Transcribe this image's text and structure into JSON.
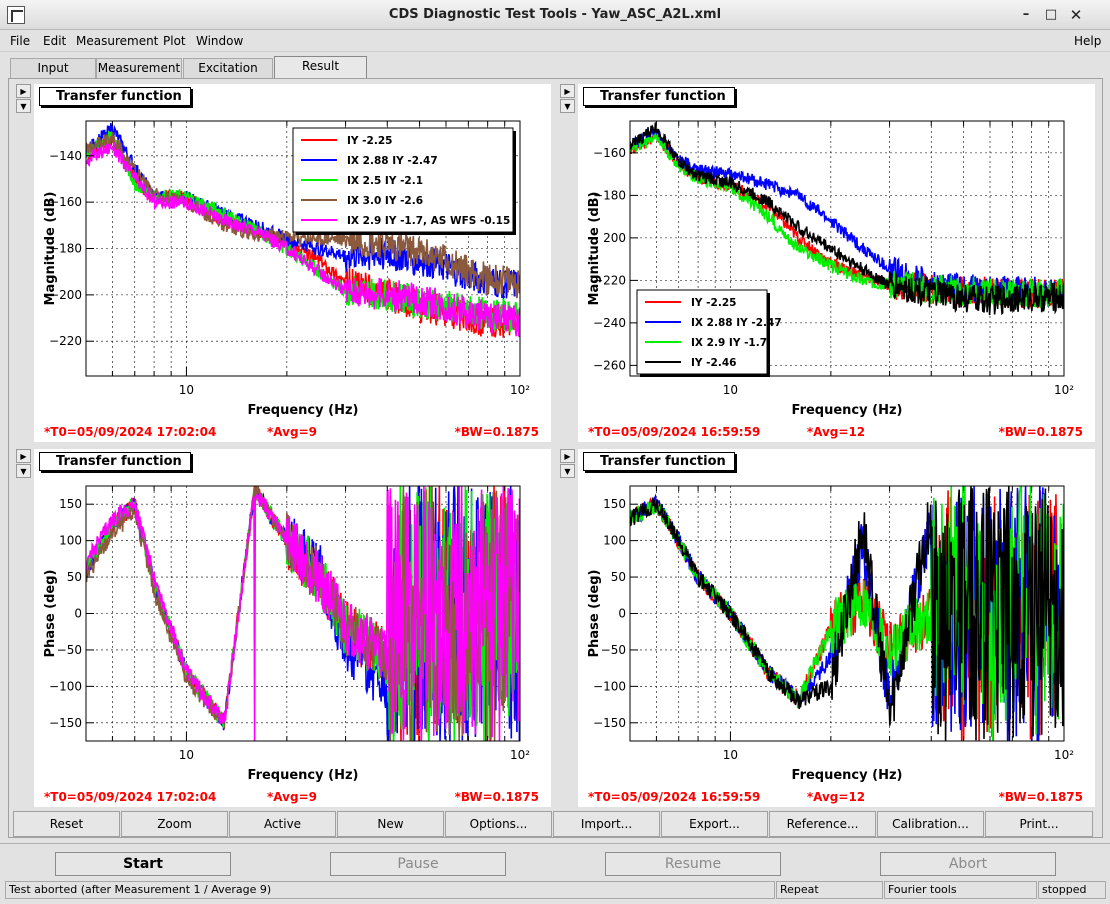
{
  "window": {
    "title": "CDS Diagnostic Test Tools - Yaw_ASC_A2L.xml",
    "minimize": "–",
    "maximize": "□",
    "close": "✕"
  },
  "menu": {
    "file": "File",
    "edit": "Edit",
    "measurement": "Measurement",
    "plot": "Plot",
    "window": "Window",
    "help": "Help"
  },
  "tabs": [
    "Input",
    "Measurement",
    "Excitation",
    "Result"
  ],
  "active_tab": "Result",
  "pads": [
    {
      "title": "Transfer function",
      "ylabel": "Magnitude (dB)",
      "xlabel": "Frequency (Hz)",
      "yticks": [
        "−140",
        "−160",
        "−180",
        "−200",
        "−220"
      ],
      "xtick10": "10",
      "xtick100": "10²",
      "footer": {
        "t0": "*T0=05/09/2024 17:02:04",
        "avg": "*Avg=9",
        "bw": "*BW=0.1875"
      },
      "legend": [
        {
          "label": "IY -2.25",
          "color": "#ff0000"
        },
        {
          "label": "IX 2.88 IY -2.47",
          "color": "#0000ff"
        },
        {
          "label": "IX 2.5 IY -2.1",
          "color": "#00ee00"
        },
        {
          "label": "IX 3.0 IY -2.6",
          "color": "#8b5a3c"
        },
        {
          "label": "IX 2.9 IY -1.7, AS WFS -0.15",
          "color": "#ff00ff"
        }
      ]
    },
    {
      "title": "Transfer function",
      "ylabel": "Magnitude (dB)",
      "xlabel": "Frequency (Hz)",
      "yticks": [
        "−160",
        "−180",
        "200",
        "−220",
        "−240",
        "−260"
      ],
      "xtick10": "10",
      "xtick100": "10²",
      "footer": {
        "t0": "*T0=05/09/2024 16:59:59",
        "avg": "*Avg=12",
        "bw": "*BW=0.1875"
      },
      "legend": [
        {
          "label": "IY -2.25",
          "color": "#ff0000"
        },
        {
          "label": "IX 2.88 IY -2.47",
          "color": "#0000ff"
        },
        {
          "label": "IX 2.9 IY -1.7",
          "color": "#00ee00"
        },
        {
          "label": "IY -2.46",
          "color": "#000000"
        }
      ]
    },
    {
      "title": "Transfer function",
      "ylabel": "Phase (deg)",
      "xlabel": "Frequency (Hz)",
      "yticks": [
        "150",
        "100",
        "50",
        "0",
        "−50",
        "−100",
        "−150"
      ],
      "xtick10": "10",
      "xtick100": "10²",
      "footer": {
        "t0": "*T0=05/09/2024 17:02:04",
        "avg": "*Avg=9",
        "bw": "*BW=0.1875"
      },
      "legend": []
    },
    {
      "title": "Transfer function",
      "ylabel": "Phase (deg)",
      "xlabel": "Frequency (Hz)",
      "yticks": [
        "150",
        "100",
        "50",
        "0",
        "−50",
        "−100",
        "−150"
      ],
      "xtick10": "10",
      "xtick100": "10²",
      "footer": {
        "t0": "*T0=05/09/2024 16:59:59",
        "avg": "*Avg=12",
        "bw": "*BW=0.1875"
      },
      "legend": []
    }
  ],
  "buttons": [
    "Reset",
    "Zoom",
    "Active",
    "New",
    "Options...",
    "Import...",
    "Export...",
    "Reference...",
    "Calibration...",
    "Print..."
  ],
  "controls": {
    "start": "Start",
    "pause": "Pause",
    "resume": "Resume",
    "abort": "Abort"
  },
  "status": {
    "message": "Test aborted (after Measurement 1 / Average 9)",
    "repeat": "Repeat",
    "fourier": "Fourier tools",
    "state": "stopped"
  },
  "chart_data": [
    {
      "type": "line",
      "title": "Transfer function",
      "xlabel": "Frequency (Hz)",
      "ylabel": "Magnitude (dB)",
      "xscale": "log",
      "xlim": [
        5,
        100
      ],
      "ylim": [
        -235,
        -125
      ],
      "grid": true,
      "legend_position": "top-right",
      "x": [
        5,
        6,
        7,
        8,
        10,
        13,
        16,
        20,
        25,
        30,
        40,
        50,
        60,
        70,
        80,
        100
      ],
      "series": [
        {
          "name": "IY -2.25",
          "color": "#ff0000",
          "values": [
            -140,
            -133,
            -150,
            -158,
            -158,
            -168,
            -172,
            -178,
            -185,
            -195,
            -200,
            -205,
            -207,
            -210,
            -212,
            -212
          ]
        },
        {
          "name": "IX 2.88 IY -2.47",
          "color": "#0000ff",
          "values": [
            -138,
            -128,
            -145,
            -158,
            -158,
            -165,
            -170,
            -176,
            -180,
            -183,
            -182,
            -185,
            -188,
            -192,
            -194,
            -196
          ]
        },
        {
          "name": "IX 2.5 IY -2.1",
          "color": "#00ee00",
          "values": [
            -139,
            -131,
            -152,
            -157,
            -158,
            -165,
            -172,
            -180,
            -190,
            -198,
            -200,
            -203,
            -205,
            -207,
            -208,
            -210
          ]
        },
        {
          "name": "IX 3.0 IY -2.6",
          "color": "#8b5a3c",
          "values": [
            -137,
            -132,
            -146,
            -156,
            -160,
            -170,
            -174,
            -175,
            -176,
            -176,
            -178,
            -182,
            -185,
            -190,
            -193,
            -195
          ]
        },
        {
          "name": "IX 2.9 IY -1.7, AS WFS -0.15",
          "color": "#ff00ff",
          "values": [
            -142,
            -136,
            -150,
            -160,
            -160,
            -168,
            -172,
            -180,
            -190,
            -198,
            -200,
            -202,
            -205,
            -208,
            -209,
            -212
          ]
        }
      ]
    },
    {
      "type": "line",
      "title": "Transfer function",
      "xlabel": "Frequency (Hz)",
      "ylabel": "Magnitude (dB)",
      "xscale": "log",
      "xlim": [
        5,
        100
      ],
      "ylim": [
        -265,
        -145
      ],
      "grid": true,
      "legend_position": "bottom-left",
      "x": [
        5,
        6,
        7,
        8,
        10,
        13,
        16,
        20,
        25,
        30,
        40,
        50,
        60,
        70,
        80,
        100
      ],
      "series": [
        {
          "name": "IY -2.25",
          "color": "#ff0000",
          "values": [
            -158,
            -152,
            -165,
            -172,
            -175,
            -185,
            -200,
            -212,
            -218,
            -222,
            -224,
            -225,
            -225,
            -226,
            -226,
            -226
          ]
        },
        {
          "name": "IX 2.88 IY -2.47",
          "color": "#0000ff",
          "values": [
            -157,
            -150,
            -163,
            -168,
            -170,
            -175,
            -180,
            -192,
            -205,
            -215,
            -222,
            -224,
            -224,
            -225,
            -225,
            -226
          ]
        },
        {
          "name": "IX 2.9 IY -1.7",
          "color": "#00ee00",
          "values": [
            -158,
            -153,
            -166,
            -172,
            -176,
            -190,
            -205,
            -213,
            -220,
            -222,
            -224,
            -225,
            -226,
            -226,
            -226,
            -226
          ]
        },
        {
          "name": "IY -2.46",
          "color": "#000000",
          "values": [
            -157,
            -148,
            -164,
            -171,
            -174,
            -183,
            -195,
            -205,
            -215,
            -222,
            -226,
            -228,
            -230,
            -228,
            -228,
            -228
          ]
        }
      ]
    },
    {
      "type": "line",
      "title": "Transfer function",
      "xlabel": "Frequency (Hz)",
      "ylabel": "Phase (deg)",
      "xscale": "log",
      "xlim": [
        5,
        100
      ],
      "ylim": [
        -175,
        175
      ],
      "grid": true,
      "x": [
        5,
        6,
        7,
        8,
        10,
        13,
        16,
        20,
        25,
        30,
        40,
        50,
        60,
        70,
        80,
        100
      ],
      "series": [
        {
          "name": "IY -2.25",
          "color": "#ff0000",
          "values": [
            60,
            120,
            150,
            40,
            -80,
            -150,
            170,
            100,
            50,
            -20,
            -60,
            -100,
            0,
            -50,
            50,
            0
          ]
        },
        {
          "name": "IX 2.88 IY -2.47",
          "color": "#0000ff",
          "values": [
            60,
            120,
            150,
            40,
            -80,
            -150,
            170,
            100,
            60,
            -40,
            -100,
            -170,
            170,
            100,
            80,
            60
          ]
        },
        {
          "name": "IX 2.5 IY -2.1",
          "color": "#00ee00",
          "values": [
            60,
            120,
            150,
            40,
            -80,
            -150,
            170,
            100,
            50,
            -20,
            -60,
            -100,
            0,
            -50,
            50,
            0
          ]
        },
        {
          "name": "IX 3.0 IY -2.6",
          "color": "#8b5a3c",
          "values": [
            50,
            110,
            140,
            30,
            -90,
            -150,
            170,
            100,
            50,
            -20,
            -60,
            -100,
            0,
            -50,
            50,
            0
          ]
        },
        {
          "name": "IX 2.9 IY -1.7, AS WFS -0.15",
          "color": "#ff00ff",
          "values": [
            70,
            130,
            150,
            50,
            -80,
            -150,
            170,
            100,
            50,
            -20,
            -60,
            -100,
            0,
            -50,
            50,
            0
          ]
        }
      ]
    },
    {
      "type": "line",
      "title": "Transfer function",
      "xlabel": "Frequency (Hz)",
      "ylabel": "Phase (deg)",
      "xscale": "log",
      "xlim": [
        5,
        100
      ],
      "ylim": [
        -175,
        175
      ],
      "grid": true,
      "x": [
        5,
        6,
        7,
        8,
        10,
        13,
        16,
        20,
        25,
        30,
        40,
        50,
        60,
        70,
        80,
        100
      ],
      "series": [
        {
          "name": "IY -2.25",
          "color": "#ff0000",
          "values": [
            130,
            150,
            100,
            50,
            0,
            -80,
            -120,
            -20,
            20,
            -50,
            0,
            30,
            -60,
            0,
            50,
            0
          ]
        },
        {
          "name": "IX 2.88 IY -2.47",
          "color": "#0000ff",
          "values": [
            130,
            150,
            100,
            50,
            0,
            -80,
            -120,
            -60,
            100,
            -120,
            120,
            -140,
            150,
            -100,
            80,
            -50
          ]
        },
        {
          "name": "IX 2.9 IY -1.7",
          "color": "#00ee00",
          "values": [
            130,
            150,
            100,
            50,
            0,
            -80,
            -120,
            -20,
            20,
            -50,
            0,
            30,
            -60,
            0,
            50,
            0
          ]
        },
        {
          "name": "IY -2.46",
          "color": "#000000",
          "values": [
            130,
            150,
            100,
            50,
            0,
            -80,
            -120,
            -100,
            120,
            -140,
            140,
            -120,
            100,
            -80,
            60,
            -20
          ]
        }
      ]
    }
  ]
}
